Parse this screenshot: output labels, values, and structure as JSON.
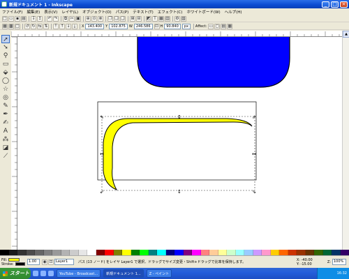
{
  "window": {
    "title": "新規ドキュメント 1 - Inkscape"
  },
  "menu": {
    "items": [
      "ファイル(F)",
      "編集(E)",
      "表示(V)",
      "レイヤ(L)",
      "オブジェクト(O)",
      "パス(P)",
      "テキスト(T)",
      "エフェクト(C)",
      "ホワイトボード(W)",
      "ヘルプ(H)"
    ]
  },
  "toolbar2": {
    "x_label": "X",
    "x_value": "143.400",
    "y_label": "Y",
    "y_value": "102.875",
    "w_label": "W",
    "w_value": "246.586",
    "h_label": "H",
    "h_value": "90.840",
    "unit": "px",
    "affect_label": "Affect:"
  },
  "palette": {
    "colors": [
      "#000000",
      "#1a1a1a",
      "#333333",
      "#4d4d4d",
      "#666666",
      "#808080",
      "#999999",
      "#b3b3b3",
      "#cccccc",
      "#e6e6e6",
      "#ffffff",
      "#800000",
      "#ff0000",
      "#808000",
      "#ffff00",
      "#008000",
      "#00ff00",
      "#008080",
      "#00ffff",
      "#000080",
      "#0000ff",
      "#800080",
      "#ff00ff",
      "#ff8080",
      "#ffcc99",
      "#ffff99",
      "#ccffcc",
      "#99ffff",
      "#99ccff",
      "#cc99ff",
      "#ff99cc",
      "#ffcc00",
      "#ff6600",
      "#cc3300",
      "#993300",
      "#663300",
      "#336600",
      "#006633",
      "#003366",
      "#330066"
    ]
  },
  "status": {
    "fill_label": "Fill:",
    "stroke_label": "Stroke:",
    "fill_color": "#ffff00",
    "stroke_color": "#000000",
    "stroke_width": "1.00",
    "layer": "Layer1",
    "message": "パス (13 ノード) をレイヤ Layer1 で選択、ドラッグでサイズ変更・Shift+ドラッグで比率を保持します。",
    "x_label": "X:",
    "x_val": "-40.00",
    "y_label": "Y:",
    "y_val": "-15.00",
    "zoom_label": "Z:",
    "zoom": "100%"
  },
  "taskbar": {
    "start": "スタート",
    "tasks": [
      "YouTube - Broadcast...",
      "新規ドキュメント 1...",
      "Z - ペイント"
    ],
    "clock": "16:32"
  },
  "canvas": {
    "blue_shape_color": "#0000ff",
    "yellow_shape_color": "#ffff00"
  }
}
